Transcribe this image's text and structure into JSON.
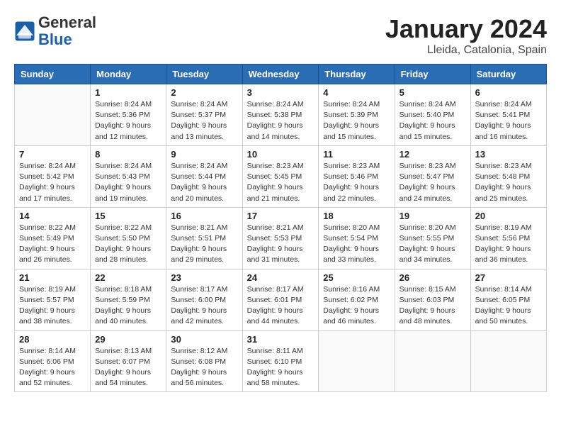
{
  "header": {
    "logo_general": "General",
    "logo_blue": "Blue",
    "month_title": "January 2024",
    "location": "Lleida, Catalonia, Spain"
  },
  "days_of_week": [
    "Sunday",
    "Monday",
    "Tuesday",
    "Wednesday",
    "Thursday",
    "Friday",
    "Saturday"
  ],
  "weeks": [
    [
      {
        "day": "",
        "sunrise": "",
        "sunset": "",
        "daylight": ""
      },
      {
        "day": "1",
        "sunrise": "Sunrise: 8:24 AM",
        "sunset": "Sunset: 5:36 PM",
        "daylight": "Daylight: 9 hours and 12 minutes."
      },
      {
        "day": "2",
        "sunrise": "Sunrise: 8:24 AM",
        "sunset": "Sunset: 5:37 PM",
        "daylight": "Daylight: 9 hours and 13 minutes."
      },
      {
        "day": "3",
        "sunrise": "Sunrise: 8:24 AM",
        "sunset": "Sunset: 5:38 PM",
        "daylight": "Daylight: 9 hours and 14 minutes."
      },
      {
        "day": "4",
        "sunrise": "Sunrise: 8:24 AM",
        "sunset": "Sunset: 5:39 PM",
        "daylight": "Daylight: 9 hours and 15 minutes."
      },
      {
        "day": "5",
        "sunrise": "Sunrise: 8:24 AM",
        "sunset": "Sunset: 5:40 PM",
        "daylight": "Daylight: 9 hours and 15 minutes."
      },
      {
        "day": "6",
        "sunrise": "Sunrise: 8:24 AM",
        "sunset": "Sunset: 5:41 PM",
        "daylight": "Daylight: 9 hours and 16 minutes."
      }
    ],
    [
      {
        "day": "7",
        "sunrise": "Sunrise: 8:24 AM",
        "sunset": "Sunset: 5:42 PM",
        "daylight": "Daylight: 9 hours and 17 minutes."
      },
      {
        "day": "8",
        "sunrise": "Sunrise: 8:24 AM",
        "sunset": "Sunset: 5:43 PM",
        "daylight": "Daylight: 9 hours and 19 minutes."
      },
      {
        "day": "9",
        "sunrise": "Sunrise: 8:24 AM",
        "sunset": "Sunset: 5:44 PM",
        "daylight": "Daylight: 9 hours and 20 minutes."
      },
      {
        "day": "10",
        "sunrise": "Sunrise: 8:23 AM",
        "sunset": "Sunset: 5:45 PM",
        "daylight": "Daylight: 9 hours and 21 minutes."
      },
      {
        "day": "11",
        "sunrise": "Sunrise: 8:23 AM",
        "sunset": "Sunset: 5:46 PM",
        "daylight": "Daylight: 9 hours and 22 minutes."
      },
      {
        "day": "12",
        "sunrise": "Sunrise: 8:23 AM",
        "sunset": "Sunset: 5:47 PM",
        "daylight": "Daylight: 9 hours and 24 minutes."
      },
      {
        "day": "13",
        "sunrise": "Sunrise: 8:23 AM",
        "sunset": "Sunset: 5:48 PM",
        "daylight": "Daylight: 9 hours and 25 minutes."
      }
    ],
    [
      {
        "day": "14",
        "sunrise": "Sunrise: 8:22 AM",
        "sunset": "Sunset: 5:49 PM",
        "daylight": "Daylight: 9 hours and 26 minutes."
      },
      {
        "day": "15",
        "sunrise": "Sunrise: 8:22 AM",
        "sunset": "Sunset: 5:50 PM",
        "daylight": "Daylight: 9 hours and 28 minutes."
      },
      {
        "day": "16",
        "sunrise": "Sunrise: 8:21 AM",
        "sunset": "Sunset: 5:51 PM",
        "daylight": "Daylight: 9 hours and 29 minutes."
      },
      {
        "day": "17",
        "sunrise": "Sunrise: 8:21 AM",
        "sunset": "Sunset: 5:53 PM",
        "daylight": "Daylight: 9 hours and 31 minutes."
      },
      {
        "day": "18",
        "sunrise": "Sunrise: 8:20 AM",
        "sunset": "Sunset: 5:54 PM",
        "daylight": "Daylight: 9 hours and 33 minutes."
      },
      {
        "day": "19",
        "sunrise": "Sunrise: 8:20 AM",
        "sunset": "Sunset: 5:55 PM",
        "daylight": "Daylight: 9 hours and 34 minutes."
      },
      {
        "day": "20",
        "sunrise": "Sunrise: 8:19 AM",
        "sunset": "Sunset: 5:56 PM",
        "daylight": "Daylight: 9 hours and 36 minutes."
      }
    ],
    [
      {
        "day": "21",
        "sunrise": "Sunrise: 8:19 AM",
        "sunset": "Sunset: 5:57 PM",
        "daylight": "Daylight: 9 hours and 38 minutes."
      },
      {
        "day": "22",
        "sunrise": "Sunrise: 8:18 AM",
        "sunset": "Sunset: 5:59 PM",
        "daylight": "Daylight: 9 hours and 40 minutes."
      },
      {
        "day": "23",
        "sunrise": "Sunrise: 8:17 AM",
        "sunset": "Sunset: 6:00 PM",
        "daylight": "Daylight: 9 hours and 42 minutes."
      },
      {
        "day": "24",
        "sunrise": "Sunrise: 8:17 AM",
        "sunset": "Sunset: 6:01 PM",
        "daylight": "Daylight: 9 hours and 44 minutes."
      },
      {
        "day": "25",
        "sunrise": "Sunrise: 8:16 AM",
        "sunset": "Sunset: 6:02 PM",
        "daylight": "Daylight: 9 hours and 46 minutes."
      },
      {
        "day": "26",
        "sunrise": "Sunrise: 8:15 AM",
        "sunset": "Sunset: 6:03 PM",
        "daylight": "Daylight: 9 hours and 48 minutes."
      },
      {
        "day": "27",
        "sunrise": "Sunrise: 8:14 AM",
        "sunset": "Sunset: 6:05 PM",
        "daylight": "Daylight: 9 hours and 50 minutes."
      }
    ],
    [
      {
        "day": "28",
        "sunrise": "Sunrise: 8:14 AM",
        "sunset": "Sunset: 6:06 PM",
        "daylight": "Daylight: 9 hours and 52 minutes."
      },
      {
        "day": "29",
        "sunrise": "Sunrise: 8:13 AM",
        "sunset": "Sunset: 6:07 PM",
        "daylight": "Daylight: 9 hours and 54 minutes."
      },
      {
        "day": "30",
        "sunrise": "Sunrise: 8:12 AM",
        "sunset": "Sunset: 6:08 PM",
        "daylight": "Daylight: 9 hours and 56 minutes."
      },
      {
        "day": "31",
        "sunrise": "Sunrise: 8:11 AM",
        "sunset": "Sunset: 6:10 PM",
        "daylight": "Daylight: 9 hours and 58 minutes."
      },
      {
        "day": "",
        "sunrise": "",
        "sunset": "",
        "daylight": ""
      },
      {
        "day": "",
        "sunrise": "",
        "sunset": "",
        "daylight": ""
      },
      {
        "day": "",
        "sunrise": "",
        "sunset": "",
        "daylight": ""
      }
    ]
  ]
}
